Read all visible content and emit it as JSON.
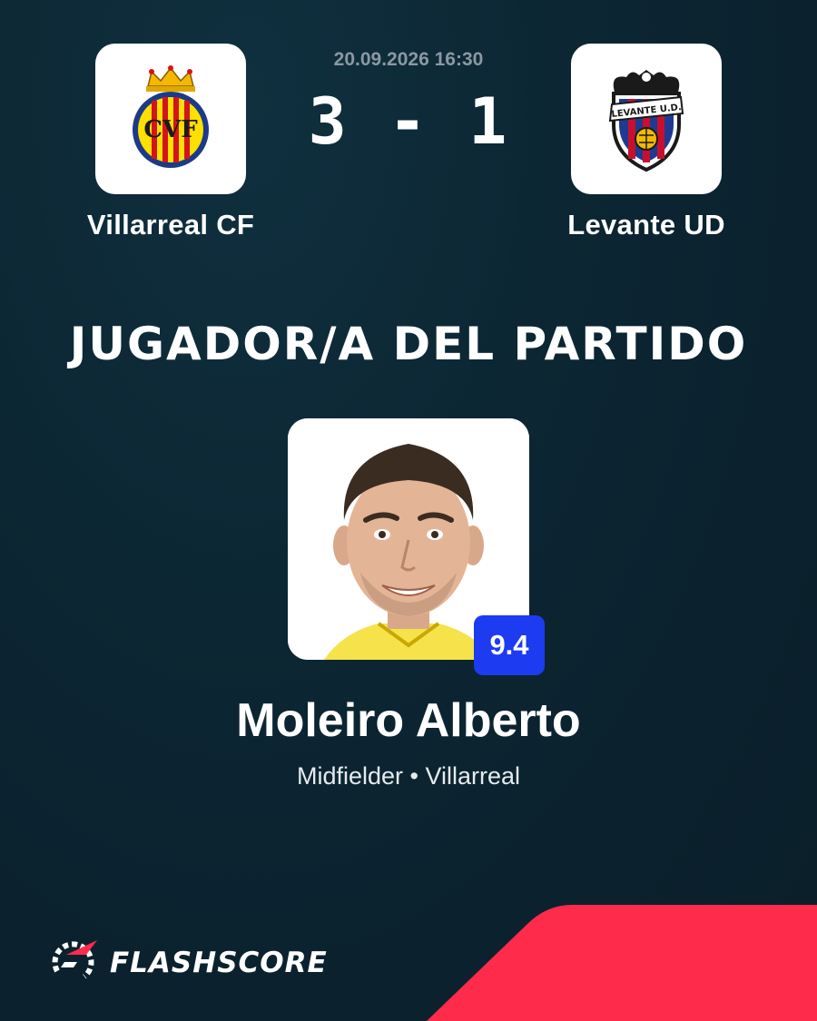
{
  "match": {
    "datetime": "20.09.2026 16:30",
    "score": "3 - 1",
    "home_team": "Villarreal CF",
    "away_team": "Levante UD",
    "home_crest_text": "CVF",
    "away_crest_text": "LEVANTE U.D."
  },
  "headline": "JUGADOR/A DEL PARTIDO",
  "player": {
    "name": "Moleiro Alberto",
    "rating": "9.4",
    "meta": "Midfielder • Villarreal"
  },
  "brand": {
    "wordmark": "FLASHSCORE"
  },
  "colors": {
    "background": "#0c2633",
    "rating_badge": "#1d3bf0",
    "accent_red": "#ff2b4a",
    "villarreal_yellow": "#ffe000",
    "villarreal_navy": "#1b3b8a",
    "levante_blue": "#1f3a93",
    "levante_red": "#c8102e"
  },
  "icons": [
    "villarreal-crest-icon",
    "levante-crest-icon",
    "flashscore-logo-icon"
  ]
}
